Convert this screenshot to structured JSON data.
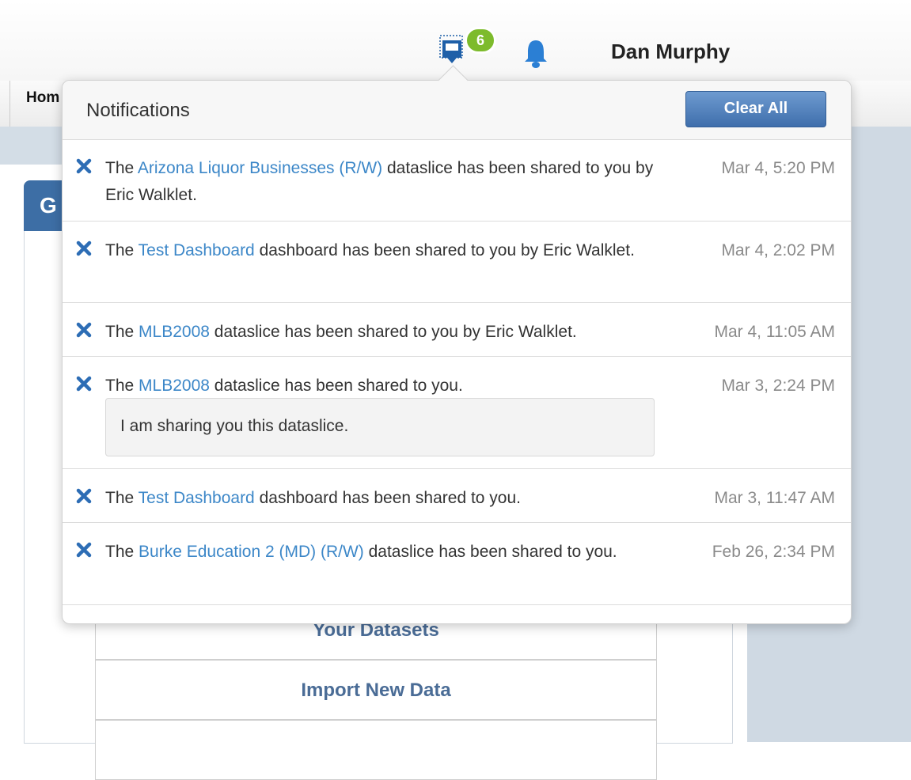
{
  "header": {
    "messages_badge": "6",
    "user_name": "Dan Murphy",
    "icons": {
      "messages": "inbox-icon",
      "alerts": "bell-icon"
    }
  },
  "nav": {
    "home_label": "Hom"
  },
  "background": {
    "card_tab_label": "G",
    "links": [
      "Your Datasets",
      "Import New Data"
    ]
  },
  "popover": {
    "title": "Notifications",
    "clear_all_label": "Clear All",
    "items": [
      {
        "prefix": "The ",
        "link": "Arizona Liquor Businesses (R/W)",
        "suffix": " dataslice has been shared to you by Eric Walklet.",
        "time": "Mar 4, 5:20 PM",
        "note": ""
      },
      {
        "prefix": "The ",
        "link": "Test Dashboard",
        "suffix": " dashboard has been shared to you by Eric Walklet.",
        "time": "Mar 4, 2:02 PM",
        "note": ""
      },
      {
        "prefix": "The ",
        "link": "MLB2008",
        "suffix": " dataslice has been shared to you by Eric Walklet.",
        "time": "Mar 4, 11:05 AM",
        "note": ""
      },
      {
        "prefix": "The ",
        "link": "MLB2008",
        "suffix": " dataslice has been shared to you.",
        "time": "Mar 3, 2:24 PM",
        "note": "I am sharing you this dataslice."
      },
      {
        "prefix": "The ",
        "link": "Test Dashboard",
        "suffix": " dashboard has been shared to you.",
        "time": "Mar 3, 11:47 AM",
        "note": ""
      },
      {
        "prefix": "The ",
        "link": "Burke Education 2 (MD) (R/W)",
        "suffix": " dataslice has been shared to you.",
        "time": "Feb 26, 2:34 PM",
        "note": ""
      }
    ]
  },
  "colors": {
    "accent": "#3d6ea5",
    "link": "#3c87c8",
    "badge": "#7dbb2c"
  }
}
